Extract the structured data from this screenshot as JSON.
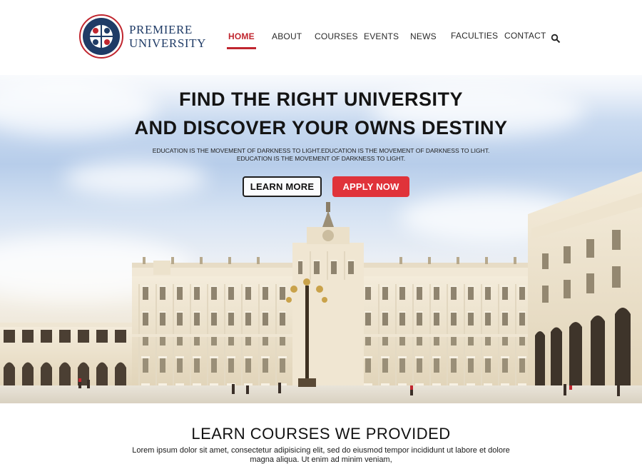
{
  "logo": {
    "line1": "PREMIERE",
    "line2": "UNIVERSITY",
    "seal_icon": "university-seal-icon",
    "brand_color": "#1f3b66",
    "accent_color": "#c0262f"
  },
  "nav": {
    "items": [
      {
        "label": "HOME",
        "active": true
      },
      {
        "label": "ABOUT",
        "active": false
      },
      {
        "label": "COURSES",
        "active": false
      },
      {
        "label": "EVENTS",
        "active": false
      },
      {
        "label": "NEWS",
        "active": false
      },
      {
        "label": "FACULTIES",
        "active": false
      },
      {
        "label": "CONTACT",
        "active": false
      }
    ],
    "search_icon": "search-icon"
  },
  "hero": {
    "title_line1": "FIND THE RIGHT UNIVERSITY",
    "title_line2": "AND DISCOVER YOUR OWNS DESTINY",
    "subtitle_line1": "EDUCATION IS THE MOVEMENT OF DARKNESS TO LIGHT.EDUCATION IS THE MOVEMENT OF DARKNESS TO LIGHT.",
    "subtitle_line2": "EDUCATION IS THE MOVEMENT OF DARKNESS TO LIGHT.",
    "learn_more_label": "LEARN MORE",
    "apply_now_label": "APPLY NOW",
    "apply_color": "#e0333a"
  },
  "courses": {
    "title": "LEARN COURSES WE PROVIDED",
    "text_line1": "Lorem ipsum dolor sit amet, consectetur adipisicing elit, sed do eiusmod tempor incididunt ut labore et dolore",
    "text_line2": "magna aliqua. Ut enim ad minim veniam,"
  }
}
